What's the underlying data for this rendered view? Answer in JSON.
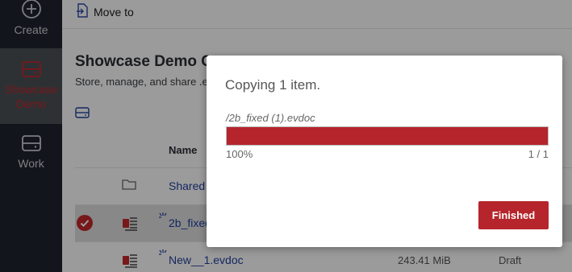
{
  "sidebar": {
    "items": [
      {
        "label": "Create",
        "icon": "plus-circle-icon"
      },
      {
        "label": "Showcase Demo",
        "icon": "drive-icon",
        "active": true
      },
      {
        "label": "Work",
        "icon": "drive-icon"
      }
    ]
  },
  "toolbar": {
    "move_to_label": "Move to"
  },
  "page": {
    "title": "Showcase Demo C",
    "subtitle": "Store, manage, and share .e"
  },
  "table": {
    "column_name": "Name",
    "rows": [
      {
        "name": "Shared",
        "type": "folder"
      },
      {
        "name": "2b_fixed",
        "type": "file",
        "selected": true
      },
      {
        "name": "New__1.evdoc",
        "type": "file",
        "size": "243.41 MiB",
        "status": "Draft"
      }
    ]
  },
  "dialog": {
    "title": "Copying 1 item.",
    "file": "/2b_fixed (1).evdoc",
    "progress": 1.0,
    "percent_label": "100%",
    "count_label": "1 / 1",
    "button_label": "Finished"
  },
  "colors": {
    "accent": "#b5252b",
    "sidebar_bg": "#1e232c",
    "link": "#1f3f9c"
  }
}
